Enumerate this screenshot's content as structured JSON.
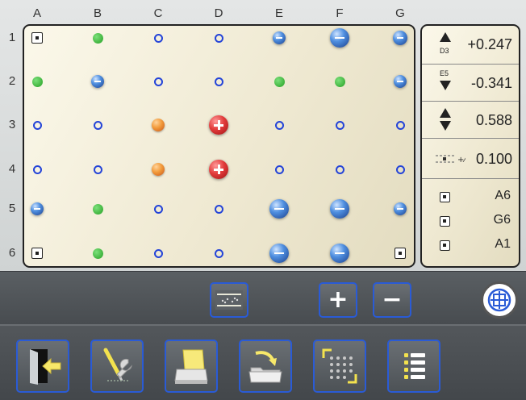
{
  "plate": {
    "columns": [
      "A",
      "B",
      "C",
      "D",
      "E",
      "F",
      "G"
    ],
    "rows": [
      "1",
      "2",
      "3",
      "4",
      "5",
      "6"
    ],
    "wells": [
      [
        "ref",
        "green",
        "empty",
        "empty",
        "blue-s",
        "blue-l",
        "blue-m"
      ],
      [
        "green",
        "blue-s",
        "empty",
        "empty",
        "green",
        "green",
        "blue-s"
      ],
      [
        "empty",
        "empty",
        "orange",
        "red",
        "empty",
        "empty",
        "empty"
      ],
      [
        "empty",
        "empty",
        "orange",
        "red",
        "empty",
        "empty",
        "empty"
      ],
      [
        "blue-s",
        "green",
        "empty",
        "empty",
        "blue-l",
        "blue-l",
        "blue-s"
      ],
      [
        "ref",
        "green",
        "empty",
        "empty",
        "blue-l",
        "blue-l",
        "ref"
      ]
    ]
  },
  "panel": {
    "max": {
      "well": "D3",
      "value": "+0.247"
    },
    "min": {
      "well": "E5",
      "value": "-0.341"
    },
    "range": {
      "value": "0.588"
    },
    "tolerance": {
      "value": "0.100"
    },
    "references": [
      "A6",
      "G6",
      "A1"
    ]
  },
  "colors": {
    "accent": "#2a5bd6",
    "empty_well": "#2444d8",
    "green_well": "#3fb33d",
    "red_well": "#e23b3b",
    "orange_well": "#f29a3a"
  },
  "toolbar": {
    "icons": [
      "tolerance-icon",
      "zoom-in-icon",
      "zoom-out-icon",
      "target-icon"
    ]
  },
  "bottom_bar": {
    "icons": [
      "exit-icon",
      "tools-icon",
      "print-icon",
      "open-folder-icon",
      "select-area-icon",
      "list-icon"
    ]
  }
}
